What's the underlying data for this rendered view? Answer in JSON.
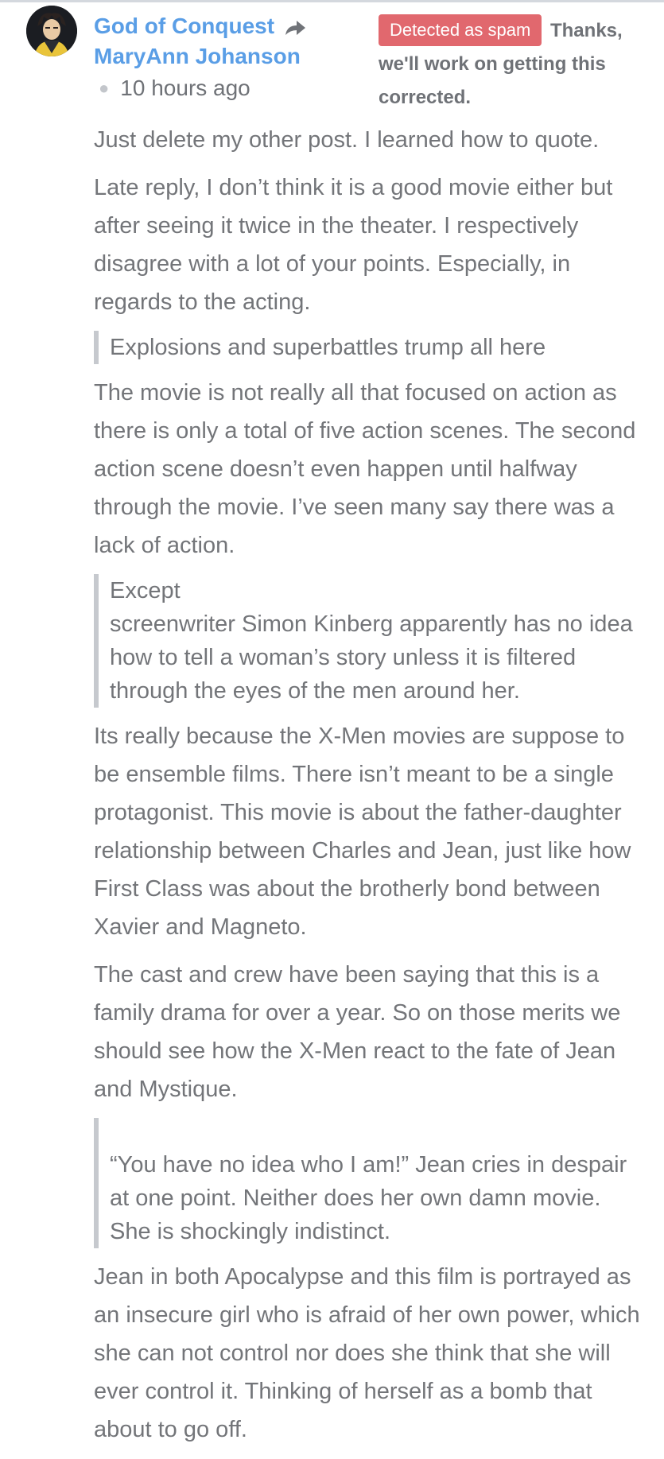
{
  "comment": {
    "author": "God of Conquest",
    "reply_to": "MaryAnn Johanson",
    "time": "10 hours ago",
    "spam_badge": "Detected as spam",
    "spam_message": "Thanks, we'll work on getting this corrected.",
    "icons": {
      "avatar": "avatar-wolverine",
      "reply": "reply-arrow-icon"
    },
    "colors": {
      "author": "#5a9ee6",
      "spam_badge": "#e1686e",
      "text": "#737579",
      "quote_border": "#c6c9ce"
    },
    "body": {
      "p1": "Just delete my other post. I learned how to quote.",
      "p2": "Late reply, I don’t think it is a good movie either but after seeing it twice in the theater. I respectively disagree with a lot of your points. Especially, in regards to the acting.",
      "quote1": "Explosions and superbattles trump all here",
      "p3": "The movie is not really all that focused on action as there is only a total of five action scenes. The second action scene doesn’t even happen until halfway through the movie. I’ve seen many say there was a lack of action.",
      "quote2_line1": "Except",
      "quote2_line2": "screenwriter Simon Kinberg apparently has no idea how to tell a woman’s story unless it is filtered through the eyes of the men around her.",
      "p4": "Its really because the X-Men movies are suppose to be ensemble films. There isn’t meant to be a single protagonist. This movie is about the father-daughter relationship between Charles and Jean, just like how First Class was about the brotherly bond between Xavier and Magneto.",
      "p5": "The cast and crew have been saying that this is a family drama for over a year. So on those merits we should see how the X-Men react to the fate of Jean and Mystique.",
      "quote3": "“You have no idea who I am!” Jean cries in despair at one point. Neither does her own damn movie. She is shockingly indistinct.",
      "p6": "Jean in both Apocalypse and this film is portrayed as an insecure girl who is afraid of her own power, which she can not control nor does she think that she will ever control it. Thinking of herself as a bomb that about to go off."
    }
  }
}
